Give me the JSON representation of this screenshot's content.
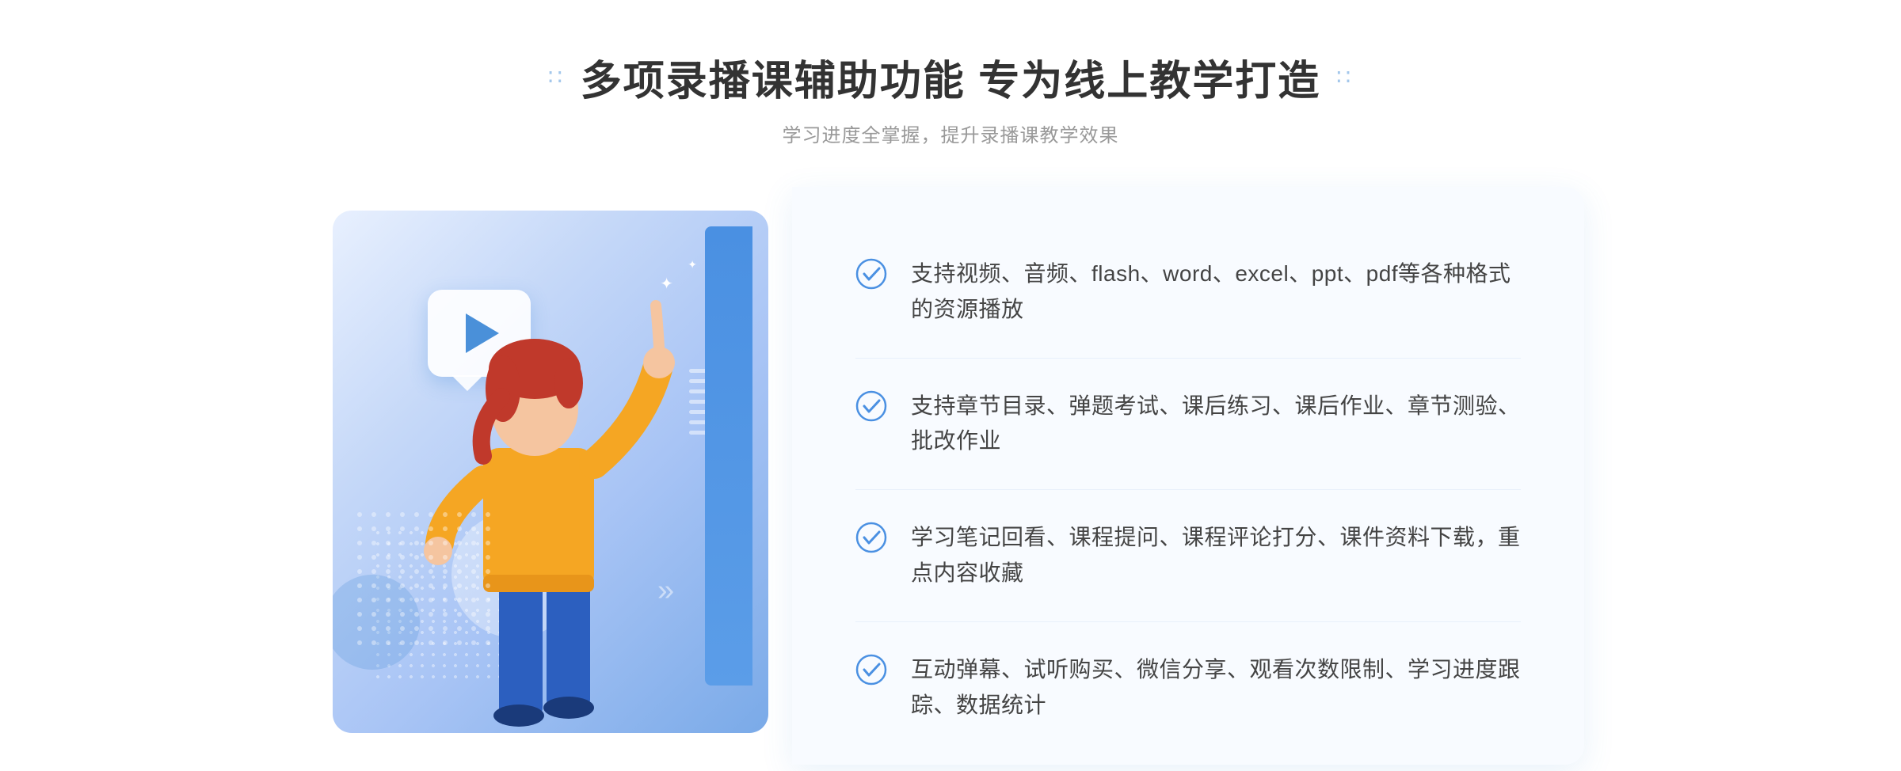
{
  "header": {
    "title": "多项录播课辅助功能 专为线上教学打造",
    "subtitle": "学习进度全掌握，提升录播课教学效果",
    "dots_left": "⠿⠿",
    "dots_right": "⠿⠿"
  },
  "features": [
    {
      "id": 1,
      "text": "支持视频、音频、flash、word、excel、ppt、pdf等各种格式的资源播放"
    },
    {
      "id": 2,
      "text": "支持章节目录、弹题考试、课后练习、课后作业、章节测验、批改作业"
    },
    {
      "id": 3,
      "text": "学习笔记回看、课程提问、课程评论打分、课件资料下载，重点内容收藏"
    },
    {
      "id": 4,
      "text": "互动弹幕、试听购买、微信分享、观看次数限制、学习进度跟踪、数据统计"
    }
  ],
  "colors": {
    "primary_blue": "#4a90e2",
    "title_color": "#333333",
    "subtitle_color": "#999999",
    "feature_text_color": "#444444",
    "check_color": "#4a90e2"
  },
  "decorations": {
    "left_arrow": "»",
    "right_dots": "∷"
  }
}
